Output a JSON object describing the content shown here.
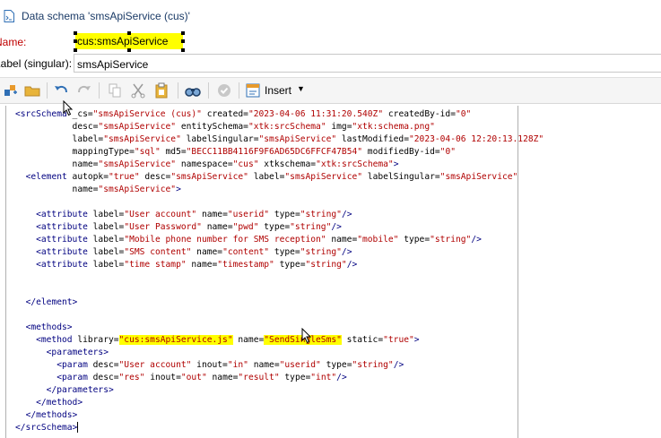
{
  "window": {
    "title": "Data schema 'smsApiService (cus)'"
  },
  "form": {
    "name_label": "Name:",
    "name_value": "cus:smsApiService",
    "label_singular_label": "Label (singular):",
    "label_singular_value": "smsApiService"
  },
  "toolbar": {
    "insert_label": "Insert",
    "icons": [
      "new-icon",
      "open-folder-icon",
      "undo-icon",
      "redo-icon",
      "copy-icon",
      "cut-icon",
      "paste-icon",
      "find-icon",
      "check-icon",
      "insert-icon"
    ]
  },
  "colors": {
    "highlight": "#ffff00",
    "tag": "#000080",
    "value": "#b00000",
    "required_label": "#c00000"
  },
  "code": {
    "l1_tag": "<srcSchema",
    "l1_a1": " _cs=",
    "l1_v1": "\"smsApiService (cus)\"",
    "l1_a2": " created=",
    "l1_v2": "\"2023-04-06 11:31:20.540Z\"",
    "l1_a3": " createdBy-id=",
    "l1_v3": "\"0\"",
    "l2_a1": "desc=",
    "l2_v1": "\"smsApiService\"",
    "l2_a2": " entitySchema=",
    "l2_v2": "\"xtk:srcSchema\"",
    "l2_a3": " img=",
    "l2_v3": "\"xtk:schema.png\"",
    "l3_a1": "label=",
    "l3_v1": "\"smsApiService\"",
    "l3_a2": " labelSingular=",
    "l3_v2": "\"smsApiService\"",
    "l3_a3": " lastModified=",
    "l3_v3": "\"2023-04-06 12:20:13.128Z\"",
    "l4_a1": "mappingType=",
    "l4_v1": "\"sql\"",
    "l4_a2": " md5=",
    "l4_v2": "\"BECC11BB4116F9F6AD65DC6FFCF47B54\"",
    "l4_a3": " modifiedBy-id=",
    "l4_v3": "\"0\"",
    "l5_a1": "name=",
    "l5_v1": "\"smsApiService\"",
    "l5_a2": " namespace=",
    "l5_v2": "\"cus\"",
    "l5_a3": " xtkschema=",
    "l5_v3": "\"xtk:srcSchema\"",
    "l5_end": ">",
    "l6_tag": "<element",
    "l6_a1": " autopk=",
    "l6_v1": "\"true\"",
    "l6_a2": " desc=",
    "l6_v2": "\"smsApiService\"",
    "l6_a3": " label=",
    "l6_v3": "\"smsApiService\"",
    "l6_a4": " labelSingular=",
    "l6_v4": "\"smsApiService\"",
    "l7_a1": "name=",
    "l7_v1": "\"smsApiService\"",
    "l7_end": ">",
    "attr_tag": "<attribute",
    "attr_label": " label=",
    "attr_name": " name=",
    "attr_type": " type=",
    "attr_end": "/>",
    "at1_label": "\"User account\"",
    "at1_name": "\"userid\"",
    "at1_type": "\"string\"",
    "at2_label": "\"User Password\"",
    "at2_name": "\"pwd\"",
    "at2_type": "\"string\"",
    "at3_label": "\"Mobile phone number for SMS reception\"",
    "at3_name": "\"mobile\"",
    "at3_type": "\"string\"",
    "at4_label": "\"SMS content\"",
    "at4_name": "\"content\"",
    "at4_type": "\"string\"",
    "at5_label": "\"time stamp\"",
    "at5_name": "\"timestamp\"",
    "at5_type": "\"string\"",
    "l_elem_close": "</element>",
    "l_methods_open": "<methods>",
    "m_tag": "<method",
    "m_a1": " library=",
    "m_v1": "\"cus:smsApiService.js\"",
    "m_a2": " name=",
    "m_v2": "\"SendSingleSms\"",
    "m_a3": " static=",
    "m_v3": "\"true\"",
    "m_end": ">",
    "l_params_open": "<parameters>",
    "p_tag": "<param",
    "p_desc": " desc=",
    "p_inout": " inout=",
    "p_name": " name=",
    "p_type": " type=",
    "p_end": "/>",
    "p1_desc": "\"User account\"",
    "p1_inout": "\"in\"",
    "p1_name": "\"userid\"",
    "p1_type": "\"string\"",
    "p2_desc": "\"res\"",
    "p2_inout": "\"out\"",
    "p2_name": "\"result\"",
    "p2_type": "\"int\"",
    "l_params_close": "</parameters>",
    "l_method_close": "</method>",
    "l_methods_close": "</methods>",
    "l_schema_close": "</srcSchema>"
  }
}
